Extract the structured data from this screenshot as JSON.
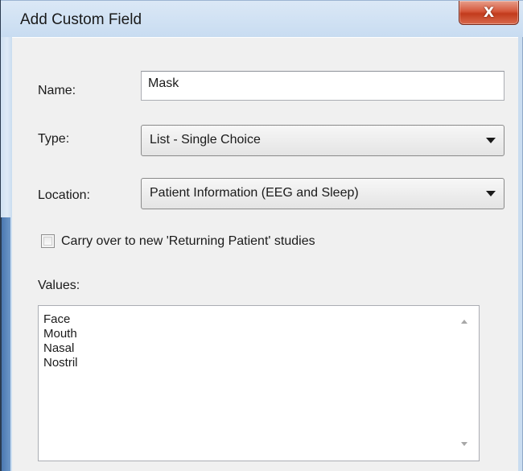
{
  "window": {
    "title": "Add Custom Field",
    "close_glyph": "X"
  },
  "form": {
    "name_label": "Name:",
    "name_value": "Mask",
    "type_label": "Type:",
    "type_value": "List - Single Choice",
    "location_label": "Location:",
    "location_value": "Patient Information (EEG and Sleep)",
    "carry_over_label": "Carry over to new 'Returning Patient' studies",
    "carry_over_checked": false,
    "values_label": "Values:",
    "values": [
      "Face",
      "Mouth",
      "Nasal",
      "Nostril"
    ]
  },
  "icons": {
    "close": "close-icon",
    "dropdown": "chevron-down-icon",
    "scroll_up": "scroll-up-arrow-icon",
    "scroll_down": "scroll-down-arrow-icon"
  },
  "colors": {
    "title_bar": "#c8dcf1",
    "close_button": "#c23b1c",
    "dialog_background": "#f0f0f0",
    "accent_strip": "#4a78b0"
  }
}
